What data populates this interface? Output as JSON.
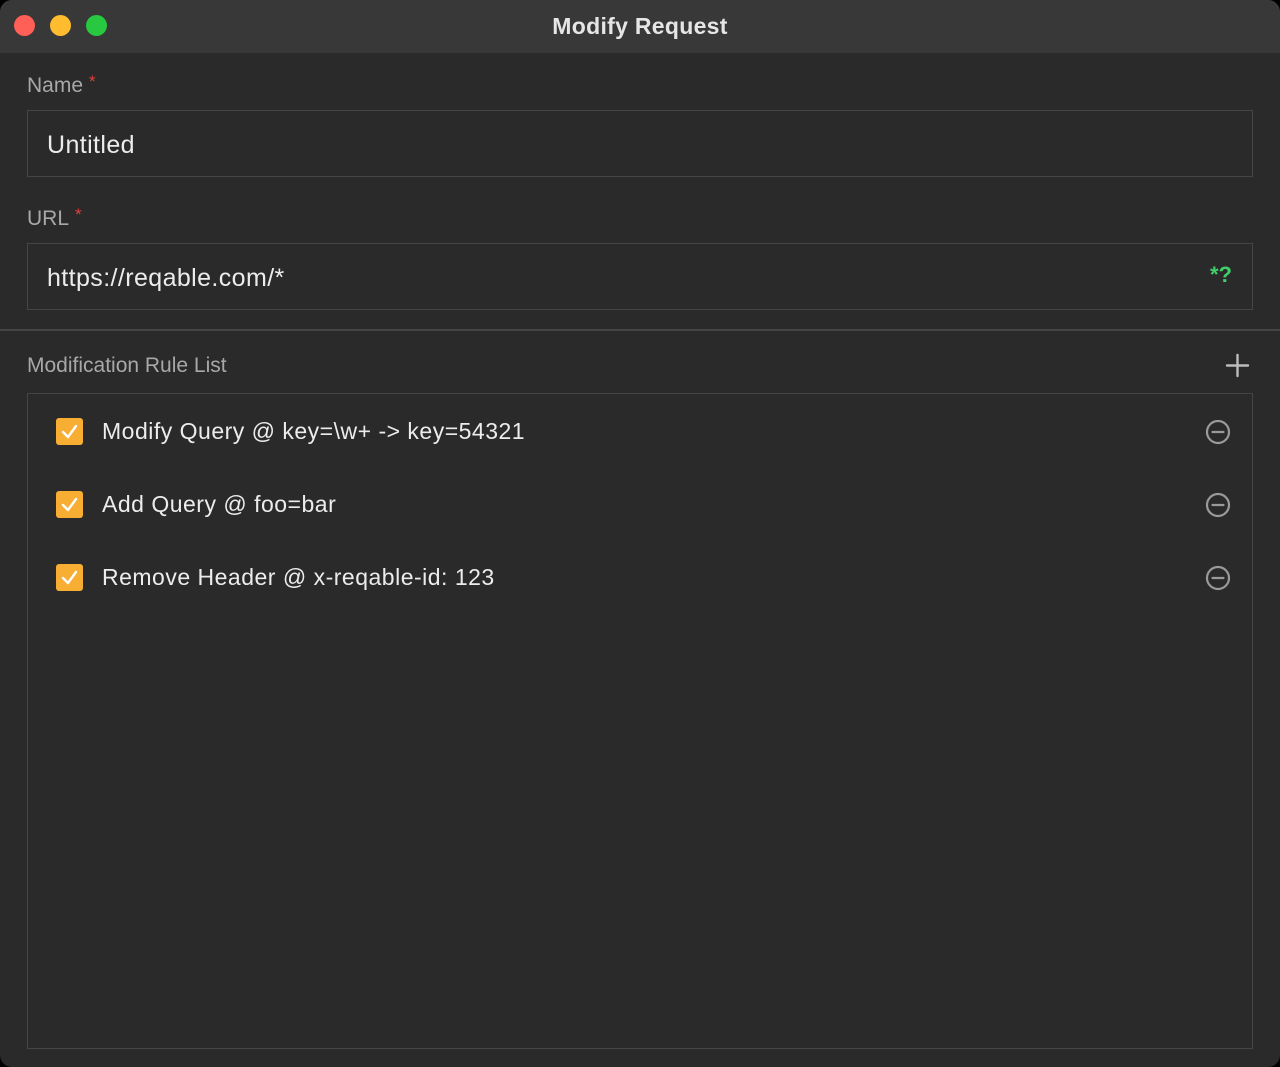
{
  "window": {
    "title": "Modify Request"
  },
  "name_field": {
    "label": "Name",
    "required_mark": "*",
    "value": "Untitled"
  },
  "url_field": {
    "label": "URL",
    "required_mark": "*",
    "value": "https://reqable.com/*",
    "regex_toggle": "*?"
  },
  "rule_list": {
    "title": "Modification Rule List",
    "add_icon": "plus-icon",
    "items": [
      {
        "label": "Modify Query @ key=\\w+ -> key=54321",
        "checked": true
      },
      {
        "label": "Add Query @ foo=bar",
        "checked": true
      },
      {
        "label": "Remove Header @ x-reqable-id: 123",
        "checked": true
      }
    ],
    "remove_icon": "minus-circle-icon"
  },
  "colors": {
    "checkbox_accent": "#f7ae33",
    "required_red": "#e0413b",
    "regex_green": "#3fd06a",
    "traffic_close": "#fe5f57",
    "traffic_minimize": "#febc2e",
    "traffic_maximize": "#28c840"
  }
}
